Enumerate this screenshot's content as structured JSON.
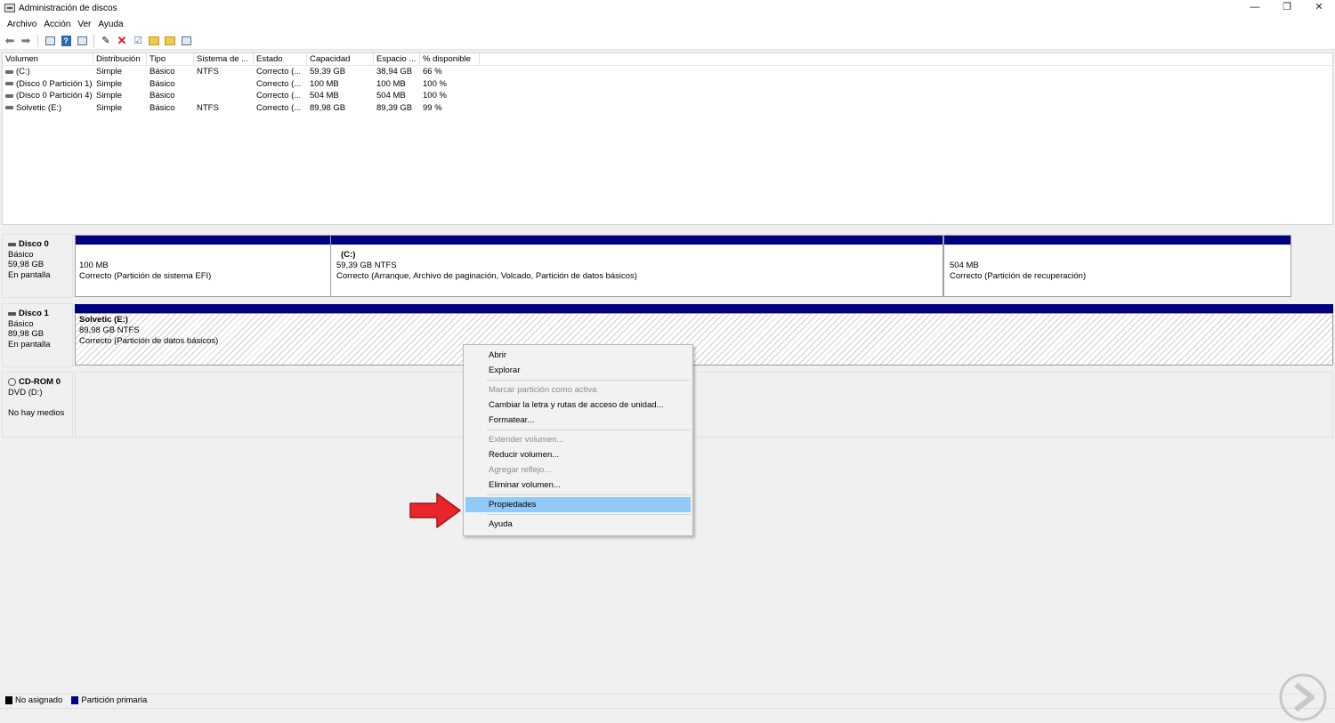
{
  "window": {
    "title": "Administración de discos",
    "minimize": "—",
    "restore": "❐",
    "close": "✕"
  },
  "menu": [
    "Archivo",
    "Acción",
    "Ver",
    "Ayuda"
  ],
  "volumes": {
    "columns": [
      "Volumen",
      "Distribución",
      "Tipo",
      "Sistema de ...",
      "Estado",
      "Capacidad",
      "Espacio ...",
      "% disponible"
    ],
    "rows": [
      [
        "(C:)",
        "Simple",
        "Básico",
        "NTFS",
        "Correcto (...",
        "59,39 GB",
        "38,94 GB",
        "66 %"
      ],
      [
        "(Disco 0 Partición 1)",
        "Simple",
        "Básico",
        "",
        "Correcto (...",
        "100 MB",
        "100 MB",
        "100 %"
      ],
      [
        "(Disco 0 Partición 4)",
        "Simple",
        "Básico",
        "",
        "Correcto (...",
        "504 MB",
        "504 MB",
        "100 %"
      ],
      [
        "Solvetic (E:)",
        "Simple",
        "Básico",
        "NTFS",
        "Correcto (...",
        "89,98 GB",
        "89,39 GB",
        "99 %"
      ]
    ]
  },
  "disks": {
    "disk0": {
      "name": "Disco 0",
      "type": "Básico",
      "size": "59,98 GB",
      "status": "En pantalla",
      "partitions": [
        {
          "title": "",
          "size": "100 MB",
          "status": "Correcto (Partición de sistema EFI)"
        },
        {
          "title": "(C:)",
          "size": "59,39 GB NTFS",
          "status": "Correcto (Arranque, Archivo de paginación, Volcado, Partición de datos básicos)"
        },
        {
          "title": "",
          "size": "504 MB",
          "status": "Correcto (Partición de recuperación)"
        }
      ]
    },
    "disk1": {
      "name": "Disco 1",
      "type": "Básico",
      "size": "89,98 GB",
      "status": "En pantalla",
      "partition": {
        "title": "Solvetic  (E:)",
        "size": "89,98 GB NTFS",
        "status": "Correcto (Partición de datos básicos)"
      }
    },
    "cdrom": {
      "name": "CD-ROM 0",
      "drive": "DVD (D:)",
      "status": "No hay medios"
    }
  },
  "context_menu": {
    "items": [
      {
        "label": "Abrir",
        "enabled": true
      },
      {
        "label": "Explorar",
        "enabled": true
      },
      {
        "label": "Marcar partición como activa",
        "enabled": false
      },
      {
        "label": "Cambiar la letra y rutas de acceso de unidad...",
        "enabled": true
      },
      {
        "label": "Formatear...",
        "enabled": true
      },
      {
        "label": "Extender volumen...",
        "enabled": false
      },
      {
        "label": "Reducir volumen...",
        "enabled": true
      },
      {
        "label": "Agregar reflejo...",
        "enabled": false
      },
      {
        "label": "Eliminar volumen...",
        "enabled": true
      },
      {
        "label": "Propiedades",
        "enabled": true,
        "highlighted": true
      },
      {
        "label": "Ayuda",
        "enabled": true
      }
    ]
  },
  "legend": [
    {
      "label": "No asignado",
      "color": "#000000"
    },
    {
      "label": "Partición primaria",
      "color": "#000080"
    }
  ],
  "colors": {
    "primary_partition_bar": "#000080",
    "menu_highlight": "#91c9f7",
    "annotation_arrow": "#e8262b"
  },
  "toolbar_icons": [
    "back-arrow-icon",
    "forward-arrow-icon",
    "console-tree-icon",
    "help-icon",
    "properties-icon",
    "connect-icon",
    "delete-icon",
    "check-icon",
    "folder-up-icon",
    "folder-icon",
    "view-icon"
  ]
}
